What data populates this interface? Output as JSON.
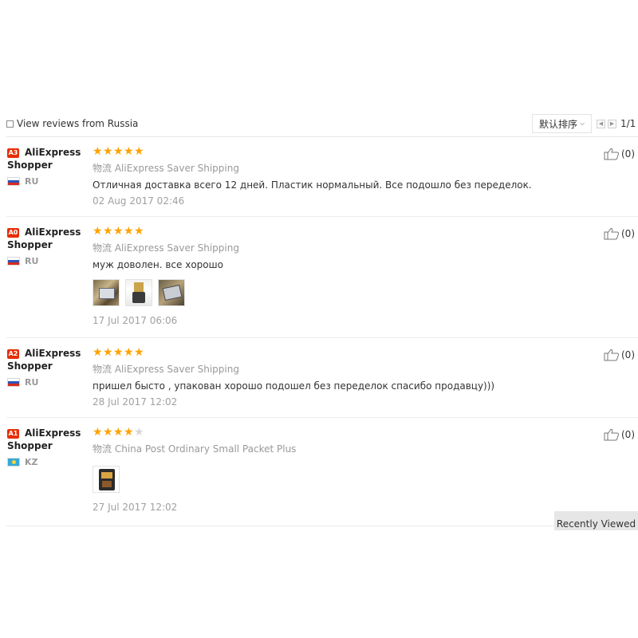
{
  "toolbar": {
    "filter_label": "View reviews from Russia",
    "sort_label": "默认排序",
    "page_text": "1/1"
  },
  "reviews": [
    {
      "badge": "A3",
      "user_line1": "AliExpress",
      "user_line2": "Shopper",
      "country": "RU",
      "stars": 5,
      "logistics_prefix": "物流",
      "logistics": "AliExpress Saver Shipping",
      "text": "Отличная доставка всего 12 дней. Пластик нормальный. Все подошло без переделок.",
      "date": "02 Aug 2017 02:46",
      "helpful": "(0)"
    },
    {
      "badge": "A0",
      "user_line1": "AliExpress",
      "user_line2": "Shopper",
      "country": "RU",
      "stars": 5,
      "logistics_prefix": "物流",
      "logistics": "AliExpress Saver Shipping",
      "text": "муж доволен. все хорошо",
      "date": "17 Jul 2017 06:06",
      "helpful": "(0)"
    },
    {
      "badge": "A2",
      "user_line1": "AliExpress",
      "user_line2": "Shopper",
      "country": "RU",
      "stars": 5,
      "logistics_prefix": "物流",
      "logistics": "AliExpress Saver Shipping",
      "text": "пришел бысто , упакован хорошо подошел без переделок спасибо продавцу)))",
      "date": "28 Jul 2017 12:02",
      "helpful": "(0)"
    },
    {
      "badge": "A1",
      "user_line1": "AliExpress",
      "user_line2": "Shopper",
      "country": "KZ",
      "stars": 4,
      "logistics_prefix": "物流",
      "logistics": "China Post Ordinary Small Packet Plus",
      "text": "",
      "date": "27 Jul 2017 12:02",
      "helpful": "(0)"
    }
  ],
  "recently_viewed": "Recently Viewed",
  "colors": {
    "star": "#ffa200",
    "badge": "#e62e04"
  }
}
